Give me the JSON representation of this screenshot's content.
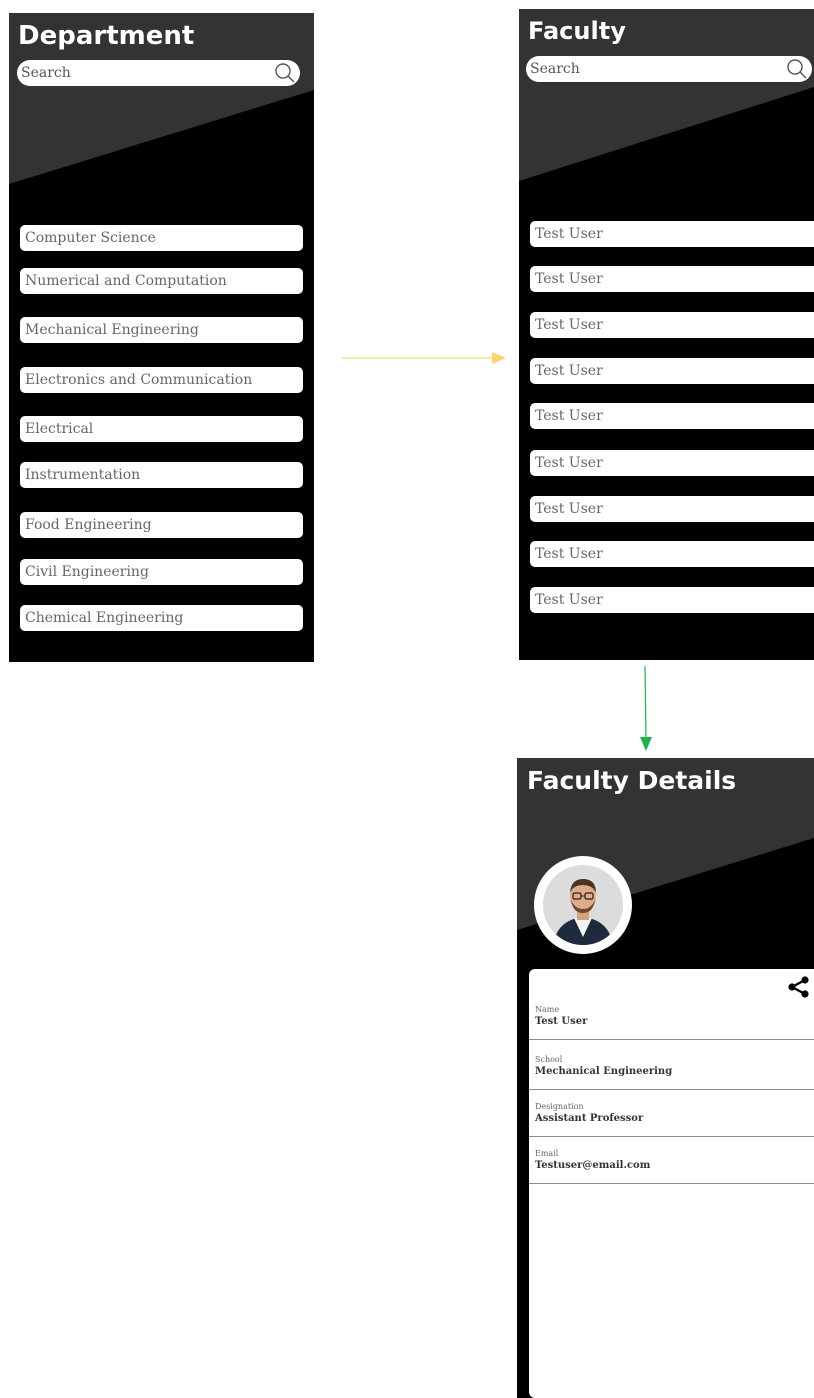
{
  "department_screen": {
    "title": "Department",
    "search_placeholder": "Search",
    "items": [
      "Computer Science",
      "Numerical and Computation",
      "Mechanical Engineering",
      "Electronics and Communication",
      "Electrical",
      "Instrumentation",
      "Food Engineering",
      "Civil Engineering",
      "Chemical Engineering"
    ]
  },
  "faculty_screen": {
    "title": "Faculty",
    "search_placeholder": "Search",
    "items": [
      "Test User",
      "Test User",
      "Test User",
      "Test User",
      "Test User",
      "Test User",
      "Test User",
      "Test User",
      "Test User"
    ]
  },
  "faculty_details_screen": {
    "title": "Faculty Details",
    "fields": [
      {
        "label": "Name",
        "value": "Test User"
      },
      {
        "label": "School",
        "value": "Mechanical Engineering"
      },
      {
        "label": "Designation",
        "value": "Assistant Professor"
      },
      {
        "label": "Email",
        "value": "Testuser@email.com"
      }
    ]
  },
  "icons": {
    "search": "search-icon",
    "share": "share-icon",
    "flow_right": "arrow-right-icon",
    "flow_down": "arrow-down-icon"
  },
  "colors": {
    "background": "#000000",
    "header_band": "#333333",
    "card": "#ffffff",
    "arrow_right": "#f9d66b",
    "arrow_down": "#1db34a"
  }
}
